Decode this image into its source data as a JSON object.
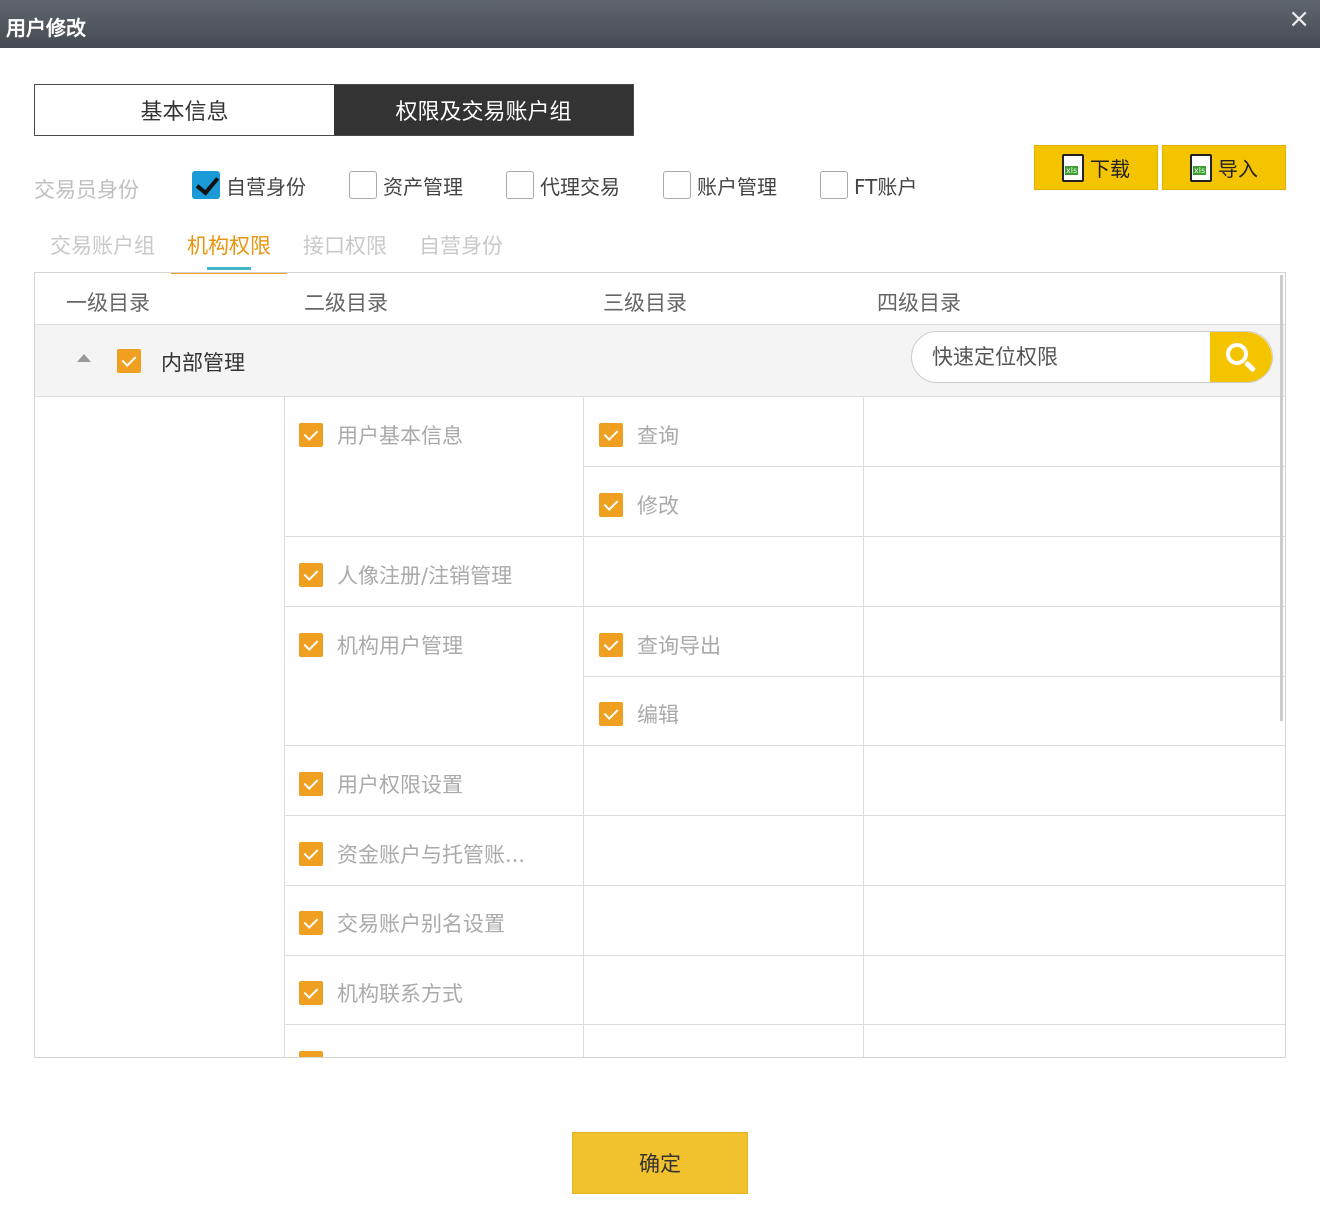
{
  "window": {
    "title": "用户修改",
    "close_icon": "×"
  },
  "main_tabs": [
    {
      "label": "基本信息"
    },
    {
      "label": "权限及交易账户组"
    }
  ],
  "identity": {
    "label": "交易员身份",
    "options": [
      {
        "label": "自营身份",
        "checked": true
      },
      {
        "label": "资产管理",
        "checked": false
      },
      {
        "label": "代理交易",
        "checked": false
      },
      {
        "label": "账户管理",
        "checked": false
      },
      {
        "label": "FT账户",
        "checked": false
      }
    ]
  },
  "buttons": {
    "download": "下载",
    "import": "导入",
    "confirm": "确定"
  },
  "sub_tabs": [
    {
      "label": "交易账户组"
    },
    {
      "label": "机构权限"
    },
    {
      "label": "接口权限"
    },
    {
      "label": "自营身份"
    }
  ],
  "tree": {
    "headers": [
      "一级目录",
      "二级目录",
      "三级目录",
      "四级目录"
    ],
    "group": {
      "label": "内部管理",
      "checked": true
    },
    "search_placeholder": "快速定位权限",
    "level2": [
      {
        "label": "用户基本信息",
        "checked": true
      },
      {
        "label": "人像注册/注销管理",
        "checked": true
      },
      {
        "label": "机构用户管理",
        "checked": true
      },
      {
        "label": "用户权限设置",
        "checked": true
      },
      {
        "label": "资金账户与托管账...",
        "checked": true
      },
      {
        "label": "交易账户别名设置",
        "checked": true
      },
      {
        "label": "机构联系方式",
        "checked": true
      },
      {
        "label": "",
        "checked": true
      }
    ],
    "level3": [
      {
        "label": "查询",
        "checked": true
      },
      {
        "label": "修改",
        "checked": true
      },
      {
        "label": "查询导出",
        "checked": true
      },
      {
        "label": "编辑",
        "checked": true
      }
    ]
  },
  "colors": {
    "accent_yellow": "#f5c400",
    "check_orange": "#f0a020",
    "check_blue": "#1a9ad7",
    "active_tab": "#e8960f"
  }
}
